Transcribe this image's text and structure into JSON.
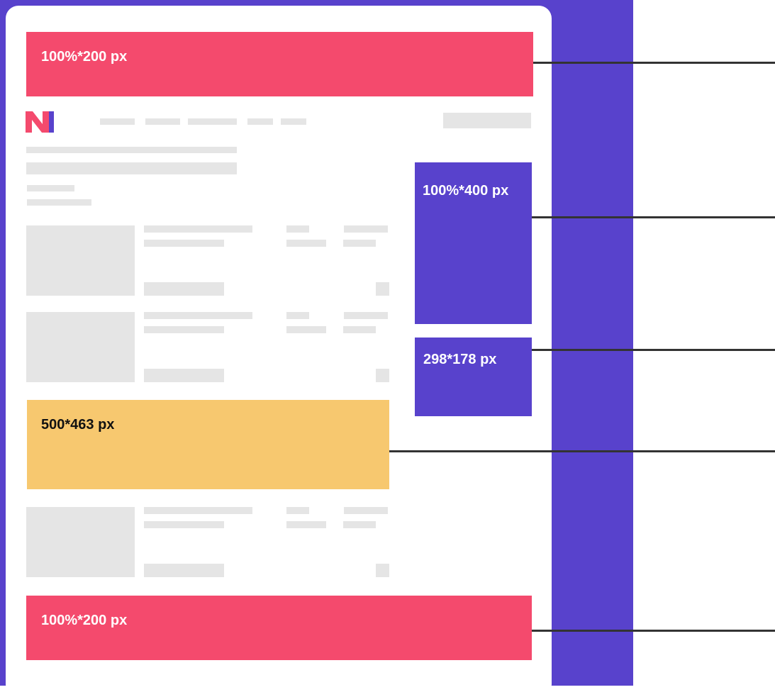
{
  "colors": {
    "purple": "#5842CC",
    "pink": "#F44A6D",
    "yellow": "#F7C86F",
    "gray": "#E5E5E5"
  },
  "logo": {
    "text": "N1",
    "icon": "n1-logo-icon"
  },
  "ad_slots": {
    "top_banner": "100%*200 px",
    "sidebar_tall": "100%*400 px",
    "sidebar_small": "298*178 px",
    "inline_block": "500*463 px",
    "bottom_banner": "100%*200 px"
  }
}
